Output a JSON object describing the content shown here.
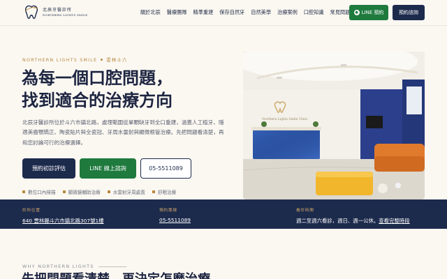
{
  "header": {
    "logo_name_zh": "北辰牙醫診所",
    "logo_name_en": "NORTHERN LIGHTS SMILE",
    "nav": [
      "關於北辰",
      "醫療團隊",
      "精準重建",
      "保存自然牙",
      "自然美學",
      "治療案例",
      "口腔知識",
      "常見問題"
    ],
    "line_button": "LINE 預約",
    "book_button": "預約諮詢"
  },
  "hero": {
    "eyebrow_en": "NORTHERN LIGHTS SMILE",
    "eyebrow_loc": "雲林斗六",
    "title_line1": "為每一個口腔問題，",
    "title_line2": "找到適合的治療方向",
    "description": "北辰牙醫診所位於斗六市鎮北路，處理範圍從單顆缺牙到全口重建，涵蓋人工植牙、隱適美齒顎矯正、陶瓷貼片與全瓷冠、牙周水雷射與顯微根管治療。先把問題看清楚，再和您討論可行的治療選擇。",
    "cta_primary": "預約初診評估",
    "cta_line": "LINE 線上諮詢",
    "cta_phone": "05-5511089",
    "features": [
      "數位口內掃描",
      "顯微鏡輔助治療",
      "水雷射牙周處置",
      "舒眠治療"
    ]
  },
  "hero_image": {
    "reception_sign": "Northern Lights Smile Clinic"
  },
  "info_bar": {
    "location_label": "診所位置",
    "location_value": "640 雲林縣斗六市鎮北路307號1樓",
    "phone_label": "預約專線",
    "phone_value": "05-5511089",
    "hours_label": "看診時間",
    "hours_value": "週二至週六看診，週日、週一公休。",
    "hours_link": "查看完整時段"
  },
  "why": {
    "label": "WHY NORTHERN LIGHTS",
    "title": "先把問題看清楚，再決定怎麼治療"
  },
  "colors": {
    "navy": "#1c2a4c",
    "gold": "#b8893f",
    "green": "#1f7a3e",
    "cream": "#fbf8f2"
  }
}
